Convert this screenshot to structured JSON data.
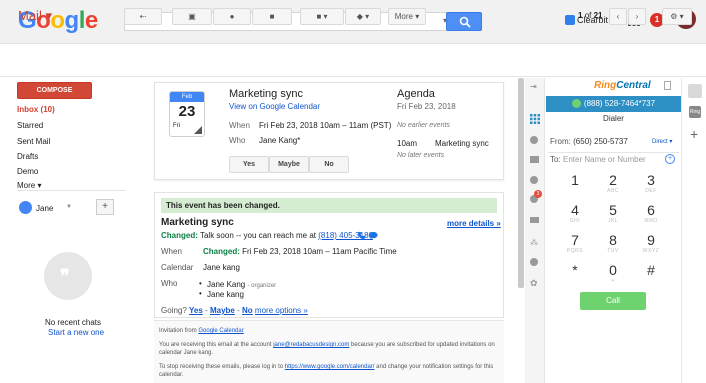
{
  "header": {
    "logo": "Google",
    "search_value": "",
    "clearbit_label": "Clearbit",
    "notif_count": "1",
    "avatar_initial": "J"
  },
  "toolbar": {
    "mail_label": "Mail ▾",
    "more_label": "More ▾",
    "page_current": "1",
    "page_of": "of",
    "page_total": "21"
  },
  "nav": {
    "compose_label": "COMPOSE",
    "items": [
      "Inbox (10)",
      "Starred",
      "Sent Mail",
      "Drafts",
      "Demo",
      "More ▾"
    ],
    "user_name": "Jane",
    "no_chats": "No recent chats",
    "start_new": "Start a new one"
  },
  "calendar_card": {
    "month": "Feb",
    "day": "23",
    "dow": "Fri",
    "title": "Marketing sync",
    "view_link": "View on Google Calendar",
    "when_label": "When",
    "when_value": "Fri Feb 23, 2018 10am – 11am (PST)",
    "who_label": "Who",
    "who_value": "Jane Kang*",
    "rsvp_yes": "Yes",
    "rsvp_maybe": "Maybe",
    "rsvp_no": "No",
    "agenda_title": "Agenda",
    "agenda_date": "Fri Feb 23, 2018",
    "agenda_earlier": "No earlier events",
    "agenda_time": "10am",
    "agenda_event": "Marketing sync",
    "agenda_later": "No later events"
  },
  "email": {
    "banner": "This event has been changed.",
    "title": "Marketing sync",
    "more_details": "more details »",
    "changed_label": "Changed:",
    "changed_text": "Talk soon -- you can reach me at",
    "phone": "(818) 405-3180",
    "when_label": "When",
    "when_changed": "Changed:",
    "when_value": "Fri Feb 23, 2018 10am – 11am Pacific Time",
    "calendar_label": "Calendar",
    "calendar_value": "Jane kang",
    "who_label": "Who",
    "who1": "Jane Kang",
    "who1_role": "- organizer",
    "who2": "Jane kang",
    "going_label": "Going?",
    "going_yes": "Yes",
    "going_maybe": "Maybe",
    "going_no": "No",
    "going_more": "more options »",
    "dash": "-"
  },
  "footer": {
    "line1_pre": "Invitation from",
    "line1_link": "Google Calendar",
    "line2_pre": "You are receiving this email at the account",
    "line2_link": "jane@redabacusdesign.com",
    "line2_post": "because you are subscribed for updated invitations on calendar Jane kang.",
    "line3_pre": "To stop receiving these emails, please log in to",
    "line3_link": "https://www.google.com/calendar/",
    "line3_post": "and change your notification settings for this calendar."
  },
  "ringcentral": {
    "logo_a": "Ring",
    "logo_b": "Central",
    "number_bar": "(888) 528-7464*737",
    "dialer_title": "Dialer",
    "from_label": "From:",
    "from_value": "(650) 250-5737",
    "direct_label": "Direct ▾",
    "to_label": "To:",
    "to_placeholder": "Enter Name or Number",
    "keys": [
      {
        "num": "1",
        "sub": ""
      },
      {
        "num": "2",
        "sub": "ABC"
      },
      {
        "num": "3",
        "sub": "DEF"
      },
      {
        "num": "4",
        "sub": "GHI"
      },
      {
        "num": "5",
        "sub": "JKL"
      },
      {
        "num": "6",
        "sub": "MNO"
      },
      {
        "num": "7",
        "sub": "PQRS"
      },
      {
        "num": "8",
        "sub": "TUV"
      },
      {
        "num": "9",
        "sub": "WXYZ"
      },
      {
        "num": "*",
        "sub": ""
      },
      {
        "num": "0",
        "sub": "+"
      },
      {
        "num": "#",
        "sub": ""
      }
    ],
    "call_label": "Call",
    "badge": "3"
  },
  "colors": {
    "accent_red": "#d23f31",
    "compose": "#d14836",
    "search_blue": "#4d8ff4",
    "rc_bar": "#2d8fc4",
    "call_green": "#6ed26e",
    "changed_green": "#d5ecd2"
  }
}
